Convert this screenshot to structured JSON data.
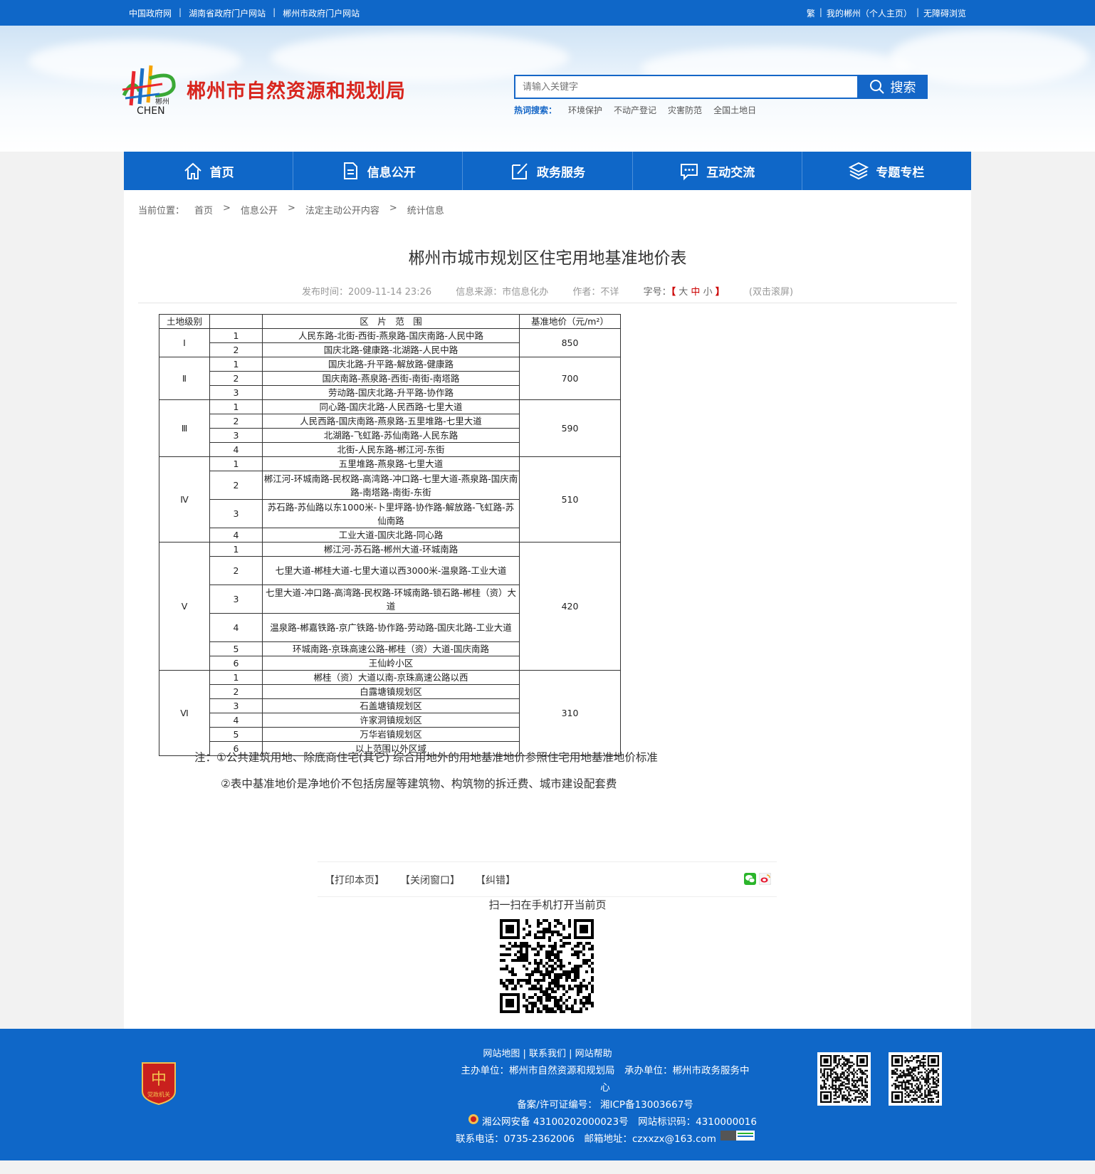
{
  "topbar": {
    "left_links": [
      "中国政府网",
      "湖南省政府门户网站",
      "郴州市政府门户网站"
    ],
    "right_links": [
      "繁",
      "我的郴州（个人主页）",
      "无障碍浏览"
    ]
  },
  "header": {
    "logo_text": "CHEN",
    "logo_sub": "郴州",
    "site_title": "郴州市自然资源和规划局",
    "search_placeholder": "请输入关键字",
    "search_button": "搜索",
    "hot_label": "热词搜索：",
    "hot_words": [
      "环境保护",
      "不动产登记",
      "灾害防范",
      "全国土地日"
    ]
  },
  "nav": [
    "首页",
    "信息公开",
    "政务服务",
    "互动交流",
    "专题专栏"
  ],
  "breadcrumb": {
    "label": "当前位置：",
    "items": [
      "首页",
      "信息公开",
      "法定主动公开内容",
      "统计信息"
    ],
    "separator": ">"
  },
  "article": {
    "title": "郴州市城市规划区住宅用地基准地价表",
    "publish_time": "发布时间：2009-11-14 23:26",
    "source": "信息来源：市信息化办",
    "author": "作者：不详",
    "font_label": "字号：",
    "font_open": "【",
    "font_large": "大",
    "font_mid": "中",
    "font_small": "小",
    "font_close": "】",
    "dblclick": "(双击滚屏)"
  },
  "table": {
    "headers": [
      "土地级别",
      "区　片　范　围",
      "基准地价（元/m²）"
    ],
    "groups": [
      {
        "level": "Ⅰ",
        "price": "850",
        "rows": [
          {
            "no": "1",
            "range": "人民东路-北街-西街-燕泉路-国庆南路-人民中路"
          },
          {
            "no": "2",
            "range": "国庆北路-健康路-北湖路-人民中路"
          }
        ]
      },
      {
        "level": "Ⅱ",
        "price": "700",
        "rows": [
          {
            "no": "1",
            "range": "国庆北路-升平路-解放路-健康路"
          },
          {
            "no": "2",
            "range": "国庆南路-燕泉路-西街-南街-南塔路"
          },
          {
            "no": "3",
            "range": "劳动路-国庆北路-升平路-协作路"
          }
        ]
      },
      {
        "level": "Ⅲ",
        "price": "590",
        "rows": [
          {
            "no": "1",
            "range": "同心路-国庆北路-人民西路-七里大道"
          },
          {
            "no": "2",
            "range": "人民西路-国庆南路-燕泉路-五里堆路-七里大道"
          },
          {
            "no": "3",
            "range": "北湖路-飞虹路-苏仙南路-人民东路"
          },
          {
            "no": "4",
            "range": "北街-人民东路-郴江河-东街"
          }
        ]
      },
      {
        "level": "Ⅳ",
        "price": "510",
        "rows": [
          {
            "no": "1",
            "range": "五里堆路-燕泉路-七里大道"
          },
          {
            "no": "2",
            "range": "郴江河-环城南路-民权路-高湾路-冲口路-七里大道-燕泉路-国庆南路-南塔路-南街-东街"
          },
          {
            "no": "3",
            "range": "苏石路-苏仙路以东1000米-卜里坪路-协作路-解放路-飞虹路-苏仙南路"
          },
          {
            "no": "4",
            "range": "工业大道-国庆北路-同心路"
          }
        ]
      },
      {
        "level": "Ⅴ",
        "price": "420",
        "rows": [
          {
            "no": "1",
            "range": "郴江河-苏石路-郴州大道-环城南路"
          },
          {
            "no": "2",
            "range": "七里大道-郴桂大道-七里大道以西3000米-温泉路-工业大道"
          },
          {
            "no": "3",
            "range": "七里大道-冲口路-高湾路-民权路-环城南路-锁石路-郴桂（资）大道"
          },
          {
            "no": "4",
            "range": "温泉路-郴嘉铁路-京广铁路-协作路-劳动路-国庆北路-工业大道"
          },
          {
            "no": "5",
            "range": "环城南路-京珠高速公路-郴桂（资）大道-国庆南路"
          },
          {
            "no": "6",
            "range": "王仙岭小区"
          }
        ]
      },
      {
        "level": "Ⅵ",
        "price": "310",
        "rows": [
          {
            "no": "1",
            "range": "郴桂（资）大道以南-京珠高速公路以西"
          },
          {
            "no": "2",
            "range": "白露塘镇规划区"
          },
          {
            "no": "3",
            "range": "石盖塘镇规划区"
          },
          {
            "no": "4",
            "range": "许家洞镇规划区"
          },
          {
            "no": "5",
            "range": "万华岩镇规划区"
          },
          {
            "no": "6",
            "range": "以上范围以外区域"
          }
        ]
      }
    ]
  },
  "notes": [
    "注：①公共建筑用地、除底商住宅(其它) 综合用地外的用地基准地价参照住宅用地基准地价标准",
    "②表中基准地价是净地价不包括房屋等建筑物、构筑物的拆迁费、城市建设配套费"
  ],
  "tools": [
    "【打印本页】",
    "【关闭窗口】",
    "【纠错】"
  ],
  "scan_text": "扫一扫在手机打开当前页",
  "footer": {
    "links": "网站地图 | 联系我们 | 网站帮助",
    "sponsor_line1": "主办单位：郴州市自然资源和规划局　承办单位：郴州市政务服务中",
    "sponsor_line2": "心",
    "icp": "备案/许可证编号： 湘ICP备13003667号",
    "police": "湘公网安备 43100202000023号　网站标识码：4310000016",
    "contact": "联系电话：0735-2362006　邮箱地址：czxxzx@163.com",
    "badge_text": "党政机关",
    "badge_char": "中"
  },
  "colors": {
    "primary": "#0f67c8",
    "title_red": "#d8261e"
  }
}
